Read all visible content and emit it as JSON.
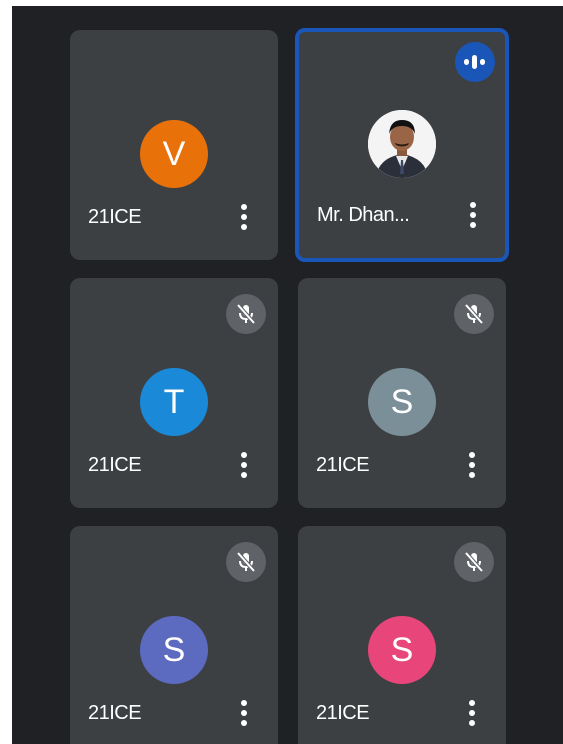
{
  "participants": [
    {
      "name": "21ICE",
      "initial": "V",
      "avatar_color": "#e8710a",
      "muted": false,
      "speaking": false
    },
    {
      "name": "Mr. Dhan...",
      "initial": "",
      "avatar_color": "#ffffff",
      "muted": false,
      "speaking": true,
      "has_photo": true
    },
    {
      "name": "21ICE",
      "initial": "T",
      "avatar_color": "#1a8ad8",
      "muted": true,
      "speaking": false
    },
    {
      "name": "21ICE",
      "initial": "S",
      "avatar_color": "#7a8f98",
      "muted": true,
      "speaking": false
    },
    {
      "name": "21ICE",
      "initial": "S",
      "avatar_color": "#5c6bc0",
      "muted": true,
      "speaking": false
    },
    {
      "name": "21ICE",
      "initial": "S",
      "avatar_color": "#e8457a",
      "muted": true,
      "speaking": false
    }
  ],
  "icons": {
    "more": "more-vert-icon",
    "muted": "mic-off-icon",
    "speaking": "audio-level-icon"
  },
  "colors": {
    "background": "#202124",
    "tile": "#3c4043",
    "speaking_border": "#1a56b8",
    "mute_badge": "#5f6368"
  }
}
